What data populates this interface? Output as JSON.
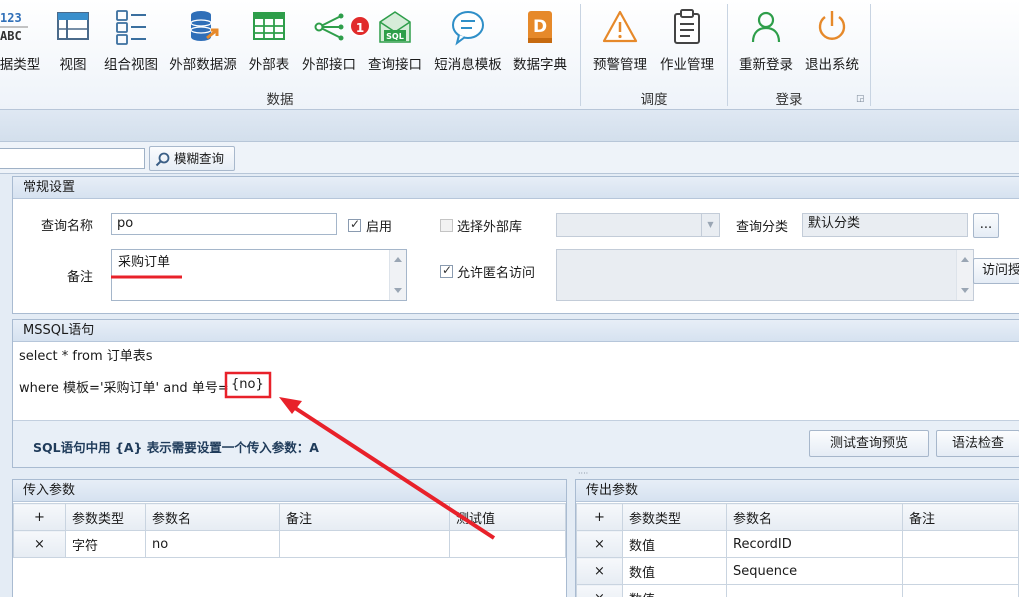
{
  "ribbon": {
    "items": [
      {
        "label": "据类型",
        "icon": "abc-123-icon"
      },
      {
        "label": "视图",
        "icon": "view-icon"
      },
      {
        "label": "组合视图",
        "icon": "combo-view-icon"
      },
      {
        "label": "外部数据源",
        "icon": "database-icon"
      },
      {
        "label": "外部表",
        "icon": "table-grid-icon"
      },
      {
        "label": "外部接口",
        "icon": "share-interface-icon"
      },
      {
        "label": "查询接口",
        "icon": "sql-envelope-icon"
      },
      {
        "label": "短消息模板",
        "icon": "chat-bubble-icon"
      },
      {
        "label": "数据字典",
        "icon": "dictionary-d-icon"
      },
      {
        "label": "预警管理",
        "icon": "warning-triangle-icon"
      },
      {
        "label": "作业管理",
        "icon": "clipboard-icon"
      },
      {
        "label": "重新登录",
        "icon": "user-icon"
      },
      {
        "label": "退出系统",
        "icon": "power-icon"
      }
    ],
    "badge": "1",
    "groups": {
      "data": "数据",
      "schedule": "调度",
      "login": "登录"
    }
  },
  "toolbar": {
    "search_value": "",
    "fuzzy_label": "模糊查询"
  },
  "general": {
    "title": "常规设置",
    "query_name_label": "查询名称",
    "query_name_value": "po",
    "enable_label": "启用",
    "enable_checked": true,
    "external_db_label": "选择外部库",
    "category_label": "查询分类",
    "category_value": "默认分类",
    "more_label": "...",
    "note_label": "备注",
    "note_value": "采购订单",
    "anon_label": "允许匿名访问",
    "anon_checked": true,
    "visit_label": "访问授"
  },
  "sql": {
    "title": "MSSQL语句",
    "line1": "select * from 订单表s",
    "line2_prefix": "where 模板='采购订单' and 单号=",
    "line2_param": "{no}",
    "hint": "SQL语句中用 {A} 表示需要设置一个传入参数：A",
    "test_btn": "测试查询预览",
    "syntax_btn": "语法检查"
  },
  "in_params": {
    "title": "传入参数",
    "headers": [
      "+",
      "参数类型",
      "参数名",
      "备注",
      "测试值"
    ],
    "rows": [
      [
        "×",
        "字符",
        "no",
        "",
        ""
      ]
    ]
  },
  "out_params": {
    "title": "传出参数",
    "headers": [
      "+",
      "参数类型",
      "参数名",
      "备注"
    ],
    "rows": [
      [
        "×",
        "数值",
        "RecordID",
        ""
      ],
      [
        "×",
        "数值",
        "Sequence",
        ""
      ],
      [
        "×",
        "数值",
        "",
        ""
      ]
    ]
  },
  "colors": {
    "annotation_red": "#e8212a",
    "ribbon_green": "#2e9e4a",
    "ribbon_blue": "#2f6fb8",
    "ribbon_orange": "#e6892a"
  }
}
